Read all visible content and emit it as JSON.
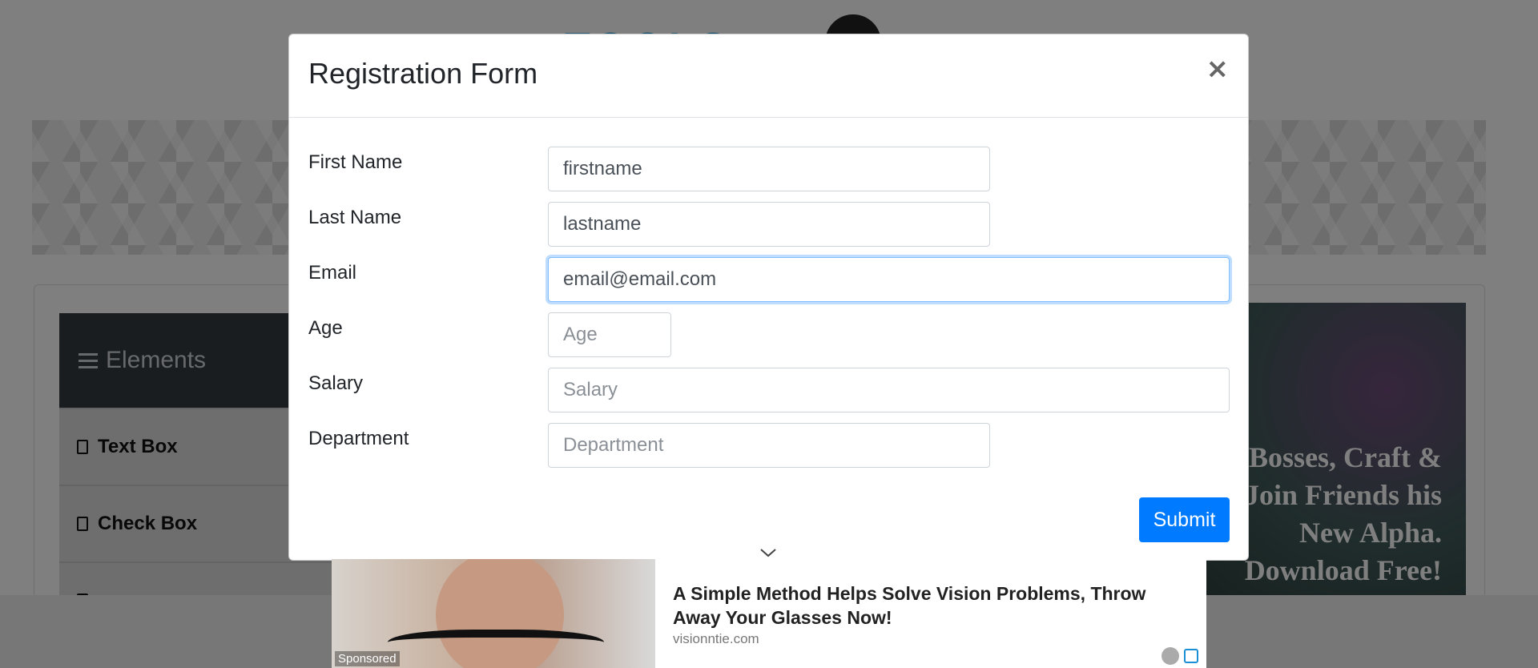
{
  "page": {
    "sidebar": {
      "header_label": "Elements",
      "items": [
        {
          "label": "Text Box"
        },
        {
          "label": "Check Box"
        }
      ]
    },
    "right_ad_text": "d Bosses, Craft & Join Friends his New Alpha. Download Free!"
  },
  "modal": {
    "title": "Registration Form",
    "close_label": "×",
    "fields": [
      {
        "label": "First Name",
        "value": "firstname",
        "placeholder": ""
      },
      {
        "label": "Last Name",
        "value": "lastname",
        "placeholder": ""
      },
      {
        "label": "Email",
        "value": "email@email.com",
        "placeholder": ""
      },
      {
        "label": "Age",
        "value": "",
        "placeholder": "Age"
      },
      {
        "label": "Salary",
        "value": "",
        "placeholder": "Salary"
      },
      {
        "label": "Department",
        "value": "",
        "placeholder": "Department"
      }
    ],
    "submit_label": "Submit"
  },
  "ad": {
    "sponsored_label": "Sponsored",
    "headline": "A Simple Method Helps Solve Vision Problems, Throw Away Your Glasses Now!",
    "domain": "visionntie.com"
  },
  "colors": {
    "primary": "#007bff",
    "focus_border": "#80bdff",
    "sidebar_header": "#343a40",
    "overlay": "rgba(0,0,0,0.5)"
  },
  "icons": {
    "close": "close-icon",
    "collapse": "chevron-down-icon",
    "menu": "hamburger-icon",
    "sidebar_item": "document-icon"
  }
}
